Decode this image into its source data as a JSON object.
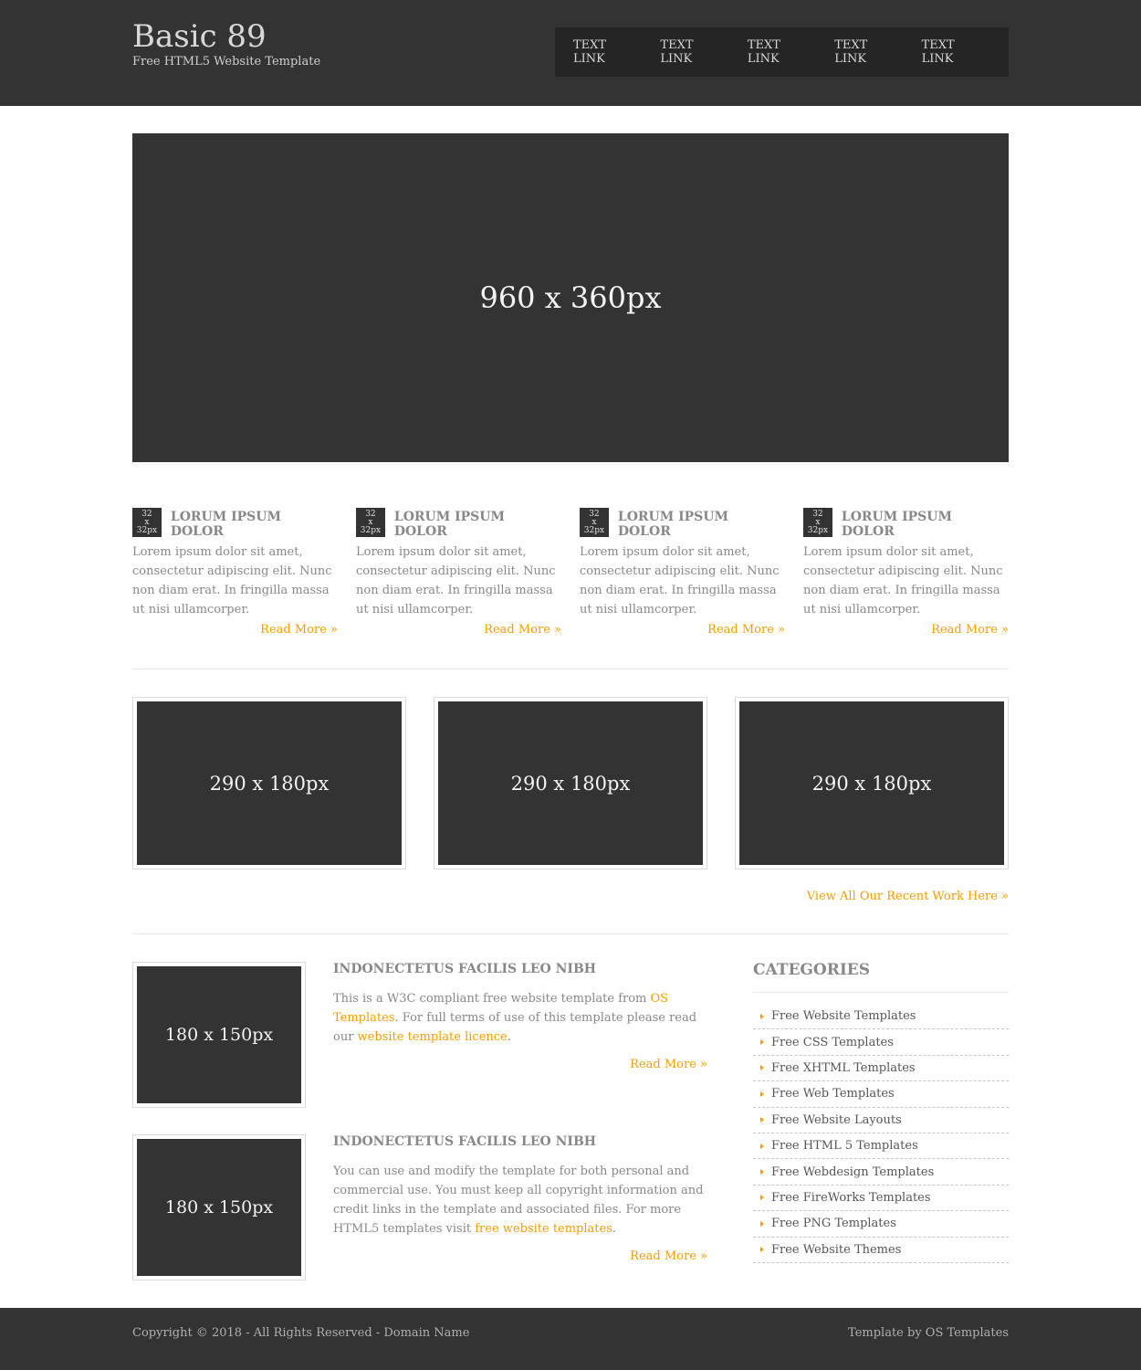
{
  "header": {
    "site_title": "Basic 89",
    "tagline": "Free HTML5 Website Template",
    "nav": [
      "TEXT LINK",
      "TEXT LINK",
      "TEXT LINK",
      "TEXT LINK",
      "TEXT LINK"
    ]
  },
  "hero": {
    "label": "960 x 360px"
  },
  "services": [
    {
      "icon_label": [
        "32",
        "x",
        "32px"
      ],
      "title": "LORUM IPSUM DOLOR",
      "text": "Lorem ipsum dolor sit amet, consectetur adipiscing elit. Nunc non diam erat. In fringilla massa ut nisi ullamcorper.",
      "more": "Read More »"
    },
    {
      "icon_label": [
        "32",
        "x",
        "32px"
      ],
      "title": "LORUM IPSUM DOLOR",
      "text": "Lorem ipsum dolor sit amet, consectetur adipiscing elit. Nunc non diam erat. In fringilla massa ut nisi ullamcorper.",
      "more": "Read More »"
    },
    {
      "icon_label": [
        "32",
        "x",
        "32px"
      ],
      "title": "LORUM IPSUM DOLOR",
      "text": "Lorem ipsum dolor sit amet, consectetur adipiscing elit. Nunc non diam erat. In fringilla massa ut nisi ullamcorper.",
      "more": "Read More »"
    },
    {
      "icon_label": [
        "32",
        "x",
        "32px"
      ],
      "title": "LORUM IPSUM DOLOR",
      "text": "Lorem ipsum dolor sit amet, consectetur adipiscing elit. Nunc non diam erat. In fringilla massa ut nisi ullamcorper.",
      "more": "Read More »"
    }
  ],
  "gallery": {
    "items": [
      "290 x 180px",
      "290 x 180px",
      "290 x 180px"
    ],
    "more": "View All Our Recent Work Here »"
  },
  "articles": [
    {
      "thumb": "180 x 150px",
      "title": "INDONECTETUS FACILIS LEO NIBH",
      "text_1": "This is a W3C compliant free website template from ",
      "link_1": "OS Templates",
      "text_2": ". For full terms of use of this template please read our ",
      "link_2": "website template licence",
      "text_3": ".",
      "more": "Read More »"
    },
    {
      "thumb": "180 x 150px",
      "title": "INDONECTETUS FACILIS LEO NIBH",
      "text_1": "You can use and modify the template for both personal and commercial use. You must keep all copyright information and credit links in the template and associated files. For more HTML5 templates visit ",
      "link_1": "free website templates",
      "text_2": ".",
      "more": "Read More »"
    }
  ],
  "sidebar": {
    "title": "CATEGORIES",
    "categories": [
      "Free Website Templates",
      "Free CSS Templates",
      "Free XHTML Templates",
      "Free Web Templates",
      "Free Website Layouts",
      "Free HTML 5 Templates",
      "Free Webdesign Templates",
      "Free FireWorks Templates",
      "Free PNG Templates",
      "Free Website Themes"
    ]
  },
  "footer": {
    "copyright": "Copyright © 2018 - All Rights Reserved - Domain Name",
    "credit": "Template by OS Templates"
  },
  "colors": {
    "dark": "#333333",
    "accent": "#F89D00",
    "text": "#888888"
  }
}
